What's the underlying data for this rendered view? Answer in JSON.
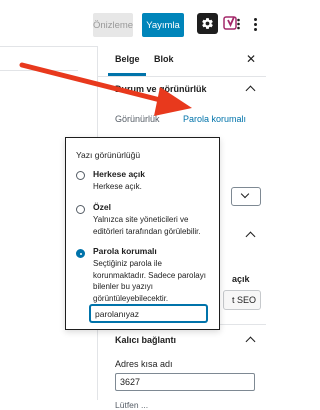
{
  "toolbar": {
    "preview_label": "Önizleme",
    "publish_label": "Yayımla",
    "yoast_label": "y!"
  },
  "sidebar": {
    "tabs": [
      {
        "label": "Belge",
        "active": true
      },
      {
        "label": "Blok",
        "active": false
      }
    ],
    "status_panel": {
      "title": "Durum ve görünürlük",
      "visibility_label": "Görünürlük",
      "visibility_value": "Parola korumalı"
    },
    "partial_label": "açık",
    "seo_button_label": "t SEO",
    "permalink_panel": {
      "title": "Kalıcı bağlantı",
      "slug_label": "Adres kısa adı",
      "slug_value": "3627",
      "bottom_text": "Lütfen ..."
    }
  },
  "popover": {
    "title": "Yazı görünürlüğü",
    "options": [
      {
        "label": "Herkese açık",
        "description": "Herkese açık.",
        "checked": false
      },
      {
        "label": "Özel",
        "description": "Yalnızca site yöneticileri ve editörleri tarafından görülebilir.",
        "checked": false
      },
      {
        "label": "Parola korumalı",
        "description": "Seçtiğiniz parola ile korunmaktadır. Sadece parolayı bilenler bu yazıyı görüntüleyebilecektir.",
        "checked": true
      }
    ],
    "password_value": "parolanıyaz"
  },
  "colors": {
    "accent": "#0073aa",
    "publish_bg": "#0085ba",
    "arrow": "#e8391d"
  }
}
